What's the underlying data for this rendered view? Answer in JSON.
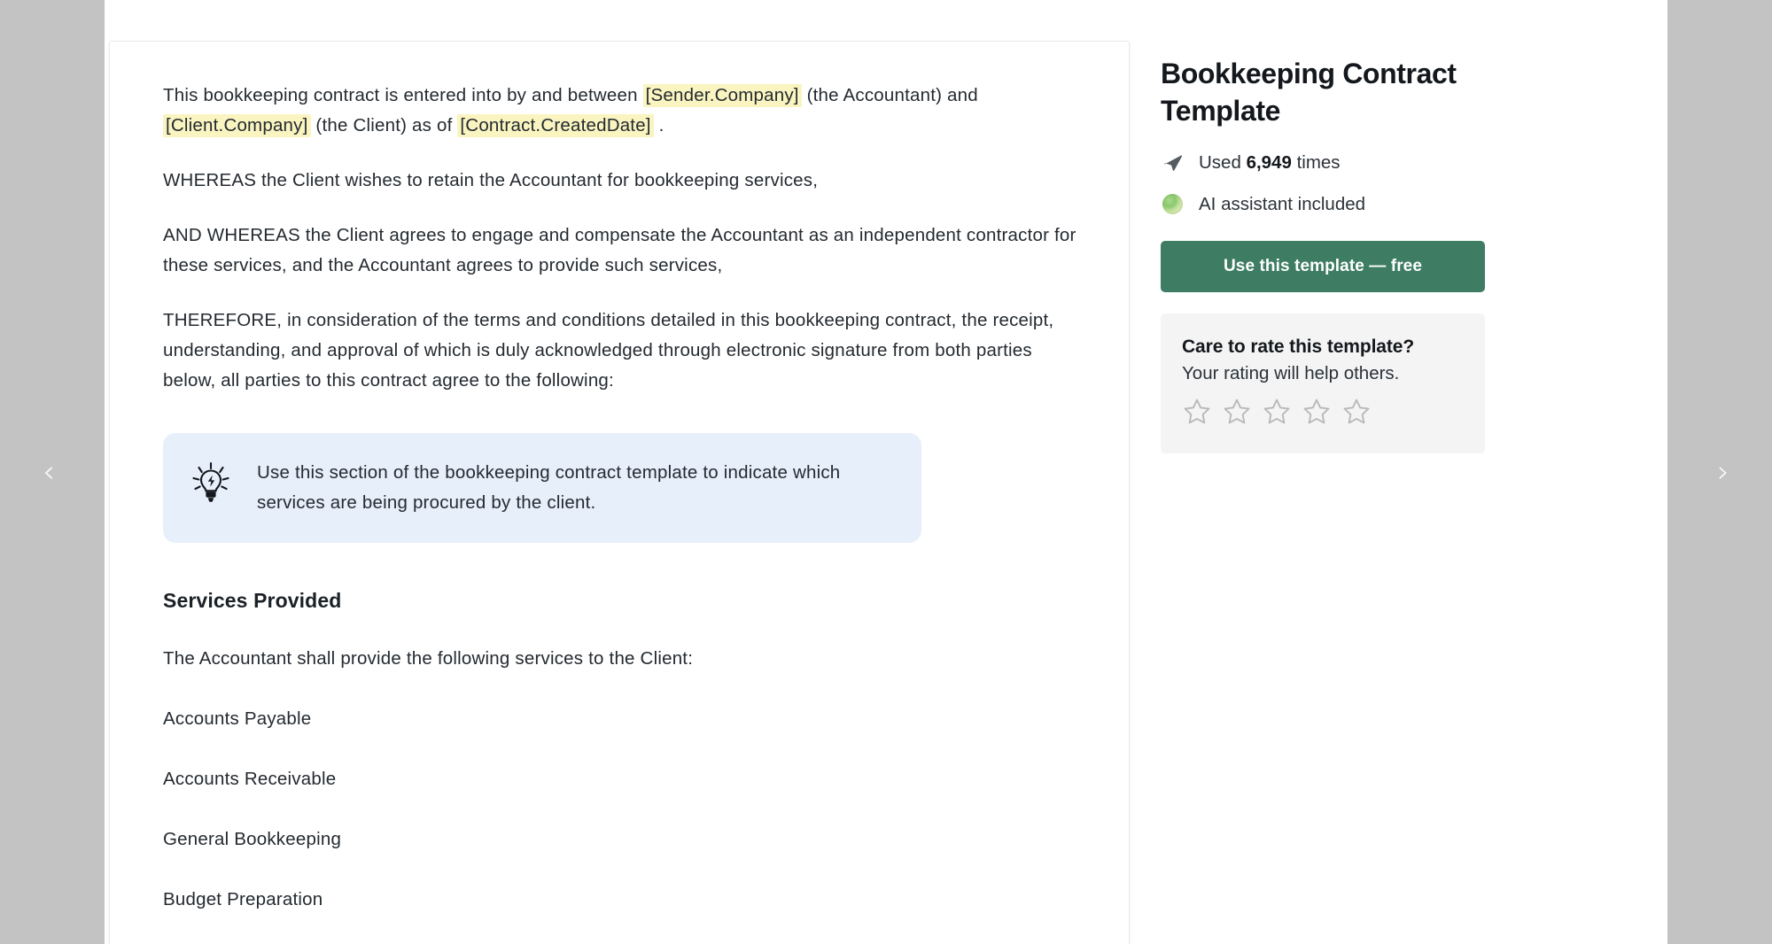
{
  "carousel": {
    "prev_label": "‹",
    "next_label": "›"
  },
  "document": {
    "paragraphs": [
      {
        "id": "intro",
        "segments": [
          {
            "type": "text",
            "value": "This bookkeeping contract is entered into by and between "
          },
          {
            "type": "token",
            "value": "[Sender.Company]"
          },
          {
            "type": "text",
            "value": " (the Accountant) and "
          },
          {
            "type": "token",
            "value": "[Client.Company]"
          },
          {
            "type": "text",
            "value": " (the Client) as of "
          },
          {
            "type": "token",
            "value": "[Contract.CreatedDate]"
          },
          {
            "type": "text",
            "value": " ."
          }
        ]
      },
      {
        "id": "whereas",
        "text": "WHEREAS the Client wishes to retain the Accountant for bookkeeping services,"
      },
      {
        "id": "and-whereas",
        "text": "AND WHEREAS the Client agrees to engage and compensate the Accountant as an independent contractor for these services, and the Accountant agrees to provide such services,"
      },
      {
        "id": "therefore",
        "text": "THEREFORE, in consideration of the terms and conditions detailed in this bookkeeping contract, the receipt, understanding, and approval of which is duly acknowledged through electronic signature from both parties below, all parties to this contract agree to the following:"
      }
    ],
    "callout": {
      "icon": "lightbulb-idea-icon",
      "text": "Use this section of the bookkeeping contract template to indicate which services are being procured by the client.",
      "background_color": "#e7effb"
    },
    "services_section": {
      "heading": "Services Provided",
      "lead": "The Accountant shall provide the following services to the Client:",
      "items": [
        "Accounts Payable",
        "Accounts Receivable",
        "General Bookkeeping",
        "Budget Preparation"
      ]
    }
  },
  "sidebar": {
    "template_title": "Bookkeeping Contract Template",
    "usage": {
      "icon": "paper-plane-icon",
      "prefix": "Used ",
      "count": "6,949",
      "suffix": " times"
    },
    "ai": {
      "icon": "ai-sphere-icon",
      "label": "AI assistant included"
    },
    "cta": {
      "label": "Use this template — free",
      "color": "#3e7c64"
    },
    "rating": {
      "title": "Care to rate this template?",
      "subtitle": "Your rating will help others.",
      "stars": [
        1,
        2,
        3,
        4,
        5
      ],
      "selected": 0,
      "star_color": "#b9b9b9"
    }
  },
  "colors": {
    "gutter": "#c3c3c3",
    "token_highlight": "#faf4c0",
    "callout_bg": "#e7effb",
    "cta_green": "#3e7c64",
    "rate_card_bg": "#f4f4f4",
    "text": "#242a30"
  }
}
